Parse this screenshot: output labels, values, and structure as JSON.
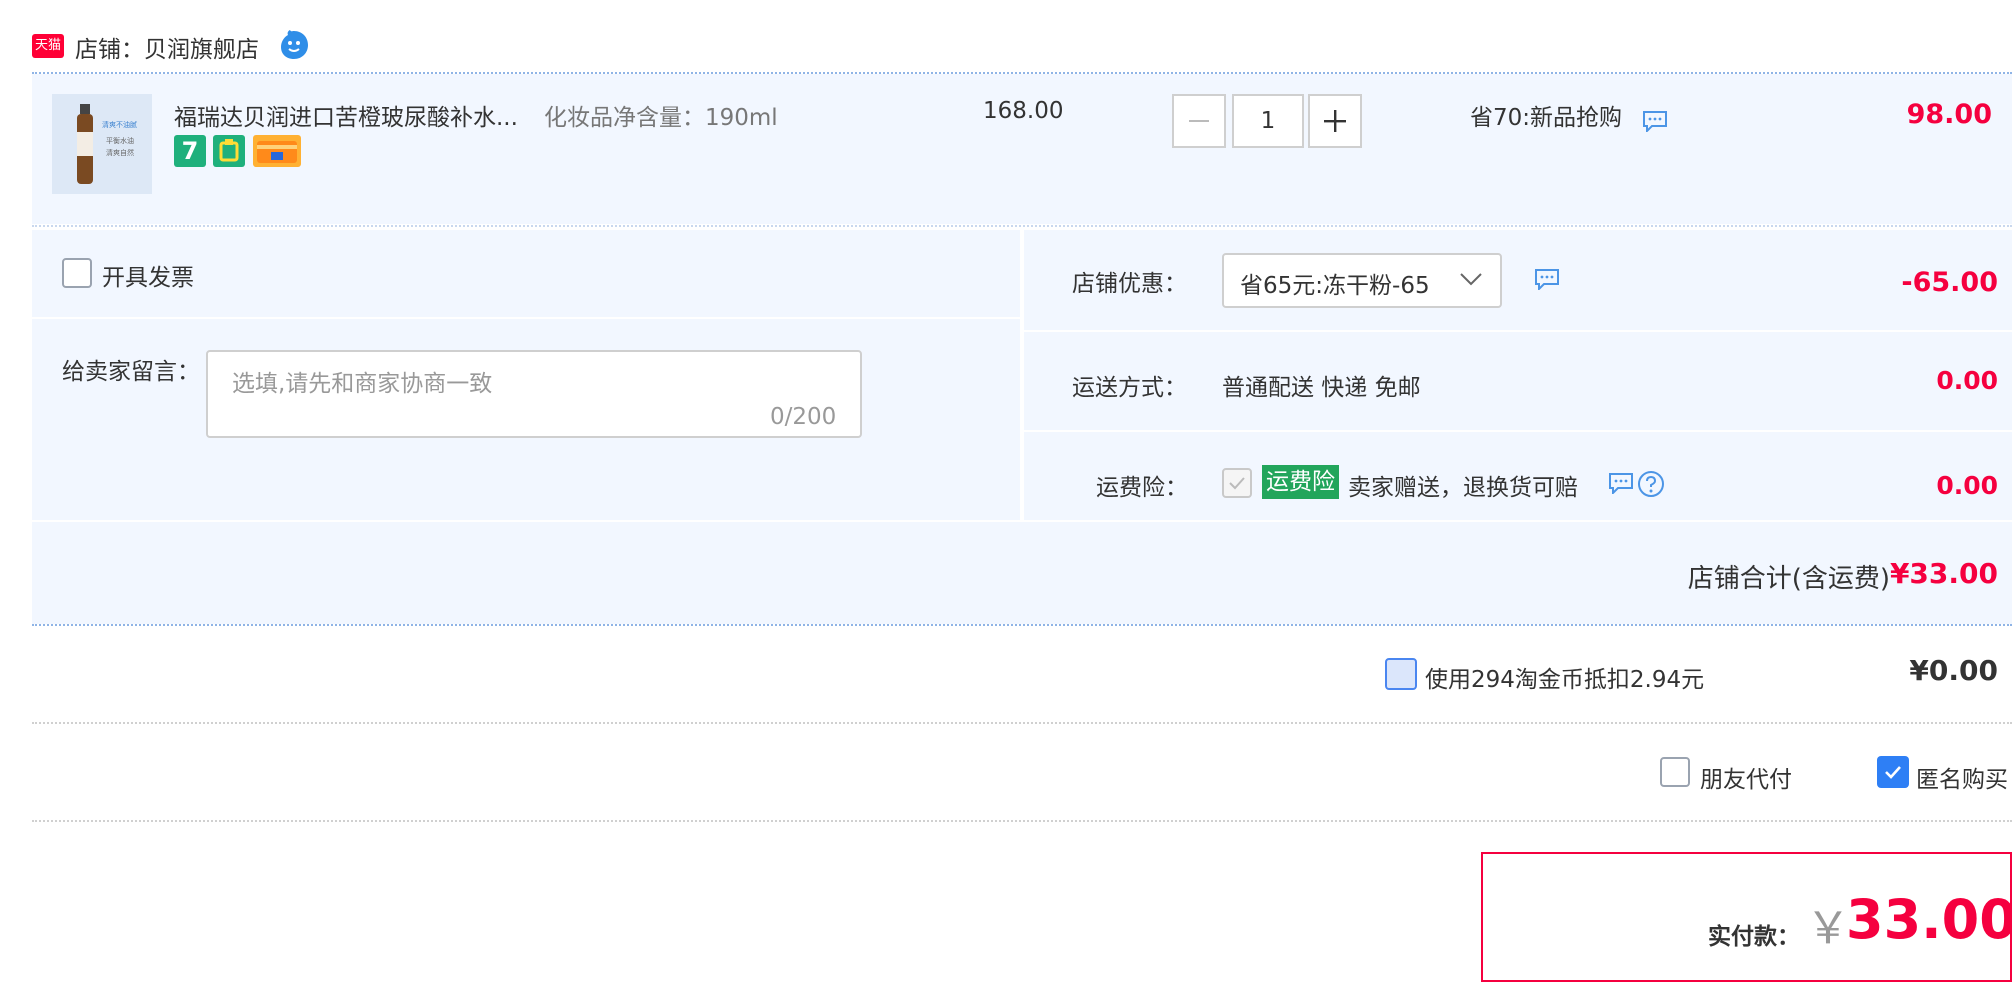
{
  "shop": {
    "logo_text": "天猫",
    "label": "店铺：贝润旗舰店"
  },
  "item": {
    "thumbnail_text": [
      "清爽不油腻",
      "平衡水油",
      "清爽自然"
    ],
    "title": "福瑞达贝润进口苦橙玻尿酸补水...",
    "sku": "化妆品净含量：190ml",
    "unit_price": "168.00",
    "badges": [
      "7-day-return-icon",
      "guarantee-icon",
      "card-pay-icon"
    ],
    "badge_text": "7",
    "quantity": "1",
    "promo": "省70:新品抢购",
    "subtotal": "98.00"
  },
  "options": {
    "invoice_label": "开具发票",
    "note_label": "给卖家留言：",
    "note_placeholder": "选填,请先和商家协商一致",
    "note_count": "0/200",
    "shop_discount_label": "店铺优惠：",
    "shop_discount_value": "省65元:冻干粉-65",
    "shop_discount_amount": "-65.00",
    "shipping_label": "运送方式：",
    "shipping_value": "普通配送 快递 免邮",
    "shipping_amount": "0.00",
    "insurance_label": "运费险：",
    "insurance_tag": "运费险",
    "insurance_desc": "卖家赠送，退换货可赔",
    "insurance_amount": "0.00"
  },
  "shop_total": {
    "label": "店铺合计(含运费)",
    "amount": "¥33.00"
  },
  "coins": {
    "label": "使用294淘金币抵扣2.94元",
    "amount": "¥0.00"
  },
  "extras": {
    "friend_pay": "朋友代付",
    "anonymous": "匿名购买"
  },
  "payment": {
    "label": "实付款：",
    "currency": "￥",
    "amount": "33.00"
  },
  "colors": {
    "accent_red": "#f5003f",
    "panel_bg": "#f2f7ff",
    "check_blue": "#2e7ff5",
    "insurance_green": "#22a55b"
  }
}
